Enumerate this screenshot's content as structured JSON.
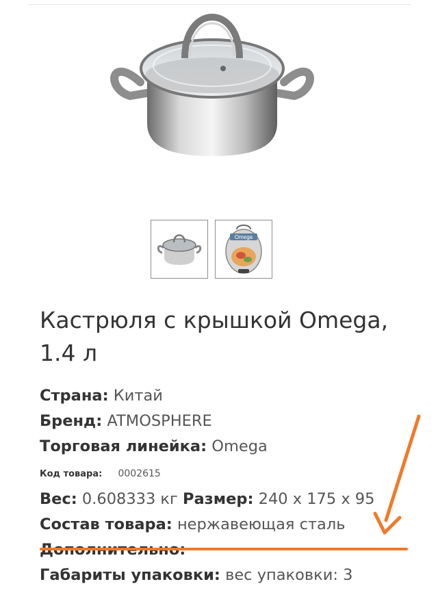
{
  "product": {
    "title": "Кастрюля с крышкой Omega, 1.4 л",
    "thumbnails": [
      {
        "icon": "pot-photo-icon"
      },
      {
        "icon": "package-photo-icon",
        "text": "Omega"
      }
    ]
  },
  "specs": {
    "country": {
      "label": "Страна:",
      "value": "Китай"
    },
    "brand": {
      "label": "Бренд:",
      "value": "ATMOSPHERE"
    },
    "line": {
      "label": "Торговая линейка:",
      "value": "Omega"
    },
    "code": {
      "label": "Код товара:",
      "value": "0002615"
    },
    "weight": {
      "label": "Вес:",
      "value": "0.608333 кг"
    },
    "size": {
      "label": "Размер:",
      "value": "240 x 175 x 95"
    },
    "composition": {
      "label": "Состав товара:",
      "value": "нержавеющая сталь"
    },
    "additional": {
      "label": "Дополнительно:"
    },
    "package": {
      "label": "Габариты упаковки:",
      "value": "вес упаковки: 3"
    }
  },
  "annotation": {
    "color": "#f07a2a",
    "icon": "arrow-down-left-icon"
  }
}
